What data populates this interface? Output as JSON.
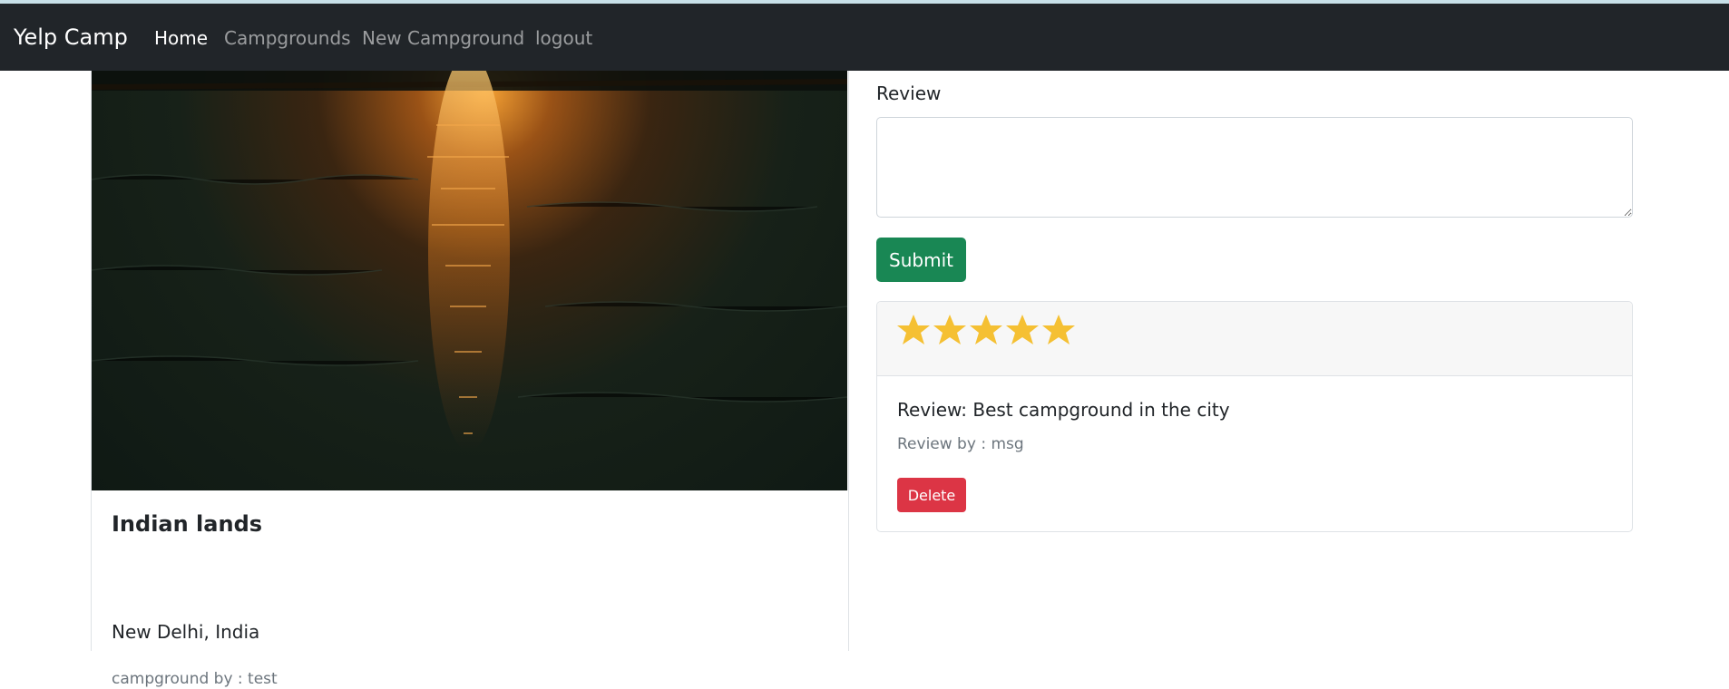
{
  "navbar": {
    "brand": "Yelp Camp",
    "links": [
      {
        "label": "Home",
        "active": true
      },
      {
        "label": "Campgrounds",
        "active": false
      },
      {
        "label": "New Campground",
        "active": false
      },
      {
        "label": "logout",
        "active": false
      }
    ],
    "background_color": "#212529"
  },
  "campground": {
    "title": "Indian lands",
    "location": "New Delhi, India",
    "author": "campground by : test",
    "image_icon": "sunset-water-image"
  },
  "review_form": {
    "label": "Review",
    "textarea_value": "",
    "submit_label": "Submit",
    "submit_color": "#198754"
  },
  "reviews": [
    {
      "rating": 5,
      "rating_max": 5,
      "text": "Review: Best campground in the city",
      "author": "Review by : msg",
      "delete_label": "Delete",
      "delete_color": "#dc3545",
      "star_color": "#f5c033"
    }
  ]
}
